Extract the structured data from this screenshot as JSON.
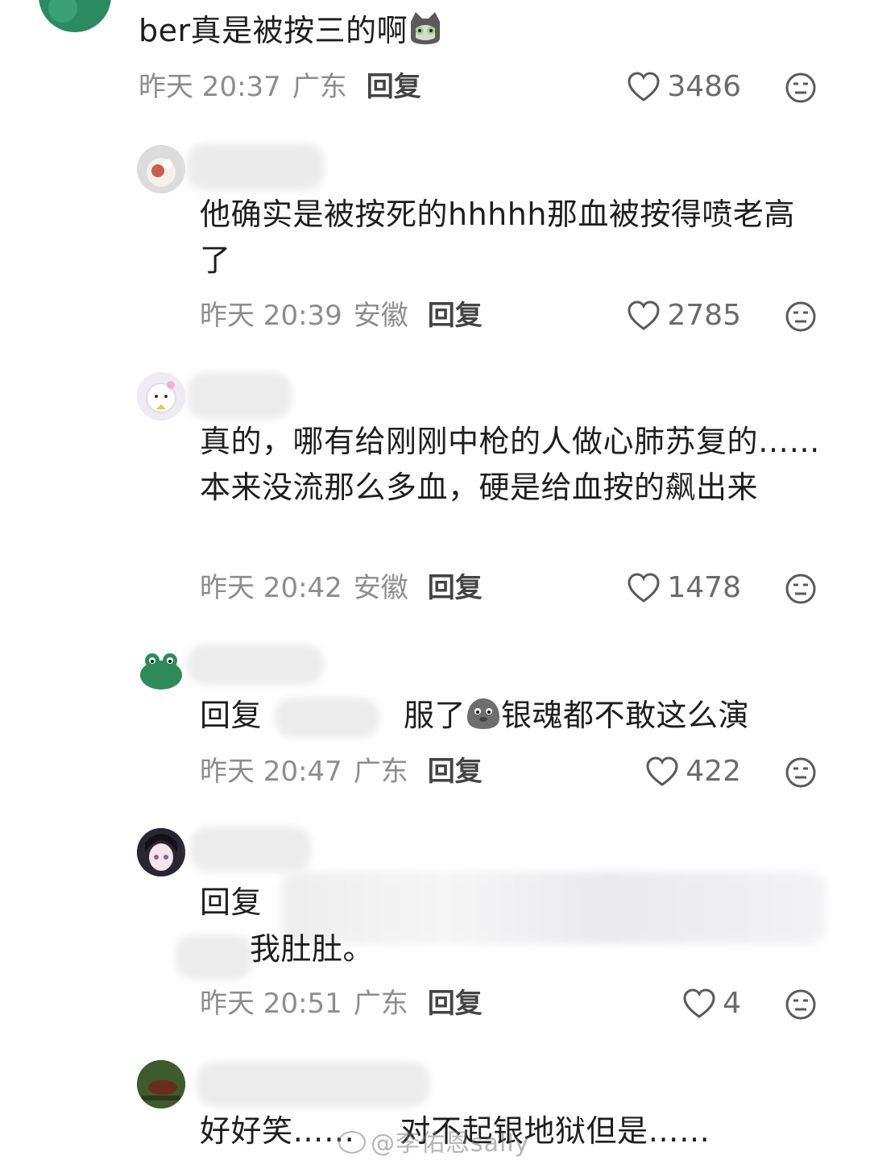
{
  "comments": [
    {
      "text": "ber真是被按三的啊",
      "emoji": "cat-face-emoji",
      "date": "昨天 20:37",
      "location": "广东",
      "reply_label": "回复",
      "likes": "3486"
    },
    {
      "text": "他确实是被按死的hhhhh那血被按得喷老高了",
      "date": "昨天 20:39",
      "location": "安徽",
      "reply_label": "回复",
      "likes": "2785"
    },
    {
      "text": "真的，哪有给刚刚中枪的人做心肺苏复的……本来没流那么多血，硬是给血按的飙出来",
      "date": "昨天 20:42",
      "location": "安徽",
      "reply_label": "回复",
      "likes": "1478"
    },
    {
      "text_prefix": "回复",
      "text_suffix": "服了",
      "text_after_emoji": "银魂都不敢这么演",
      "emoji": "seal-face-emoji",
      "date": "昨天 20:47",
      "location": "广东",
      "reply_label": "回复",
      "likes": "422"
    },
    {
      "text_prefix": "回复",
      "text_line2": "我肚肚。",
      "date": "昨天 20:51",
      "location": "广东",
      "reply_label": "回复",
      "likes": "4"
    },
    {
      "text": "好好笑……",
      "text_after": "对不起银地狱但是……"
    }
  ],
  "watermark": "@李佑恩sally",
  "colors": {
    "meta": "#8d8d8d",
    "text": "#1e1e1e",
    "icon": "#6b6b6b"
  }
}
